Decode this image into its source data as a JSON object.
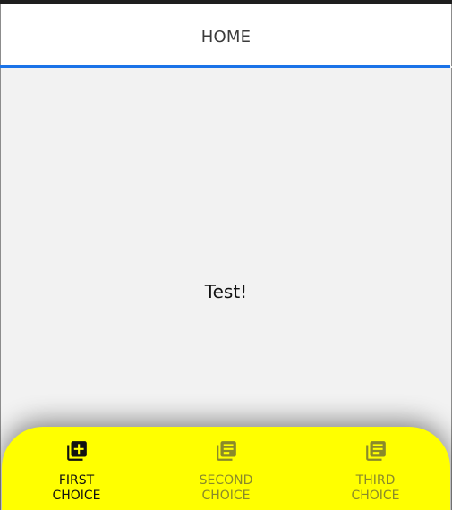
{
  "tab_bar": {
    "tabs": [
      {
        "label": "HOME"
      }
    ]
  },
  "content": {
    "text": "Test!"
  },
  "bottom_nav": {
    "items": [
      {
        "label": "FIRST\nCHOICE",
        "icon": "library-add-icon",
        "active": true
      },
      {
        "label": "SECOND\nCHOICE",
        "icon": "library-books-icon",
        "active": false
      },
      {
        "label": "THIRD\nCHOICE",
        "icon": "library-books-icon",
        "active": false
      }
    ]
  },
  "colors": {
    "nav_background": "#ffff00",
    "tab_indicator": "#1a73e8",
    "content_background": "#f2f2f2",
    "active_icon": "#111111",
    "inactive_icon": "#8a8a2a"
  }
}
